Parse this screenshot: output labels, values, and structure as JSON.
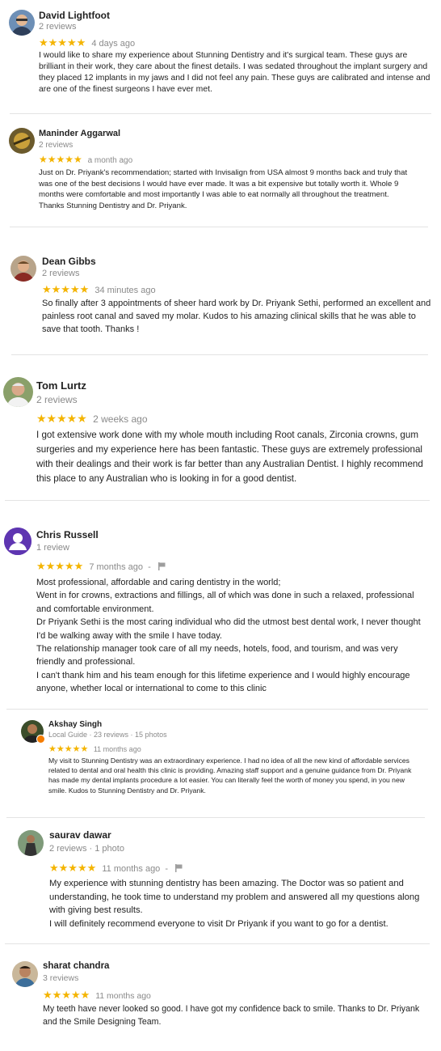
{
  "reviews": [
    {
      "name": "David Lightfoot",
      "meta": "2 reviews",
      "stars": "★★★★★",
      "time": "4 days ago",
      "text": [
        "I would like to share my experience about Stunning Dentistry and it's surgical team. These guys are brilliant in their work, they care about the finest details. I was sedated throughout the implant surgery and they placed 12 implants in my jaws and I did not feel any pain. These guys are calibrated and intense and are one of the finest surgeons I have ever met."
      ]
    },
    {
      "name": "Maninder Aggarwal",
      "meta": "2 reviews",
      "stars": "★★★★★",
      "time": "a month ago",
      "text": [
        "Just on Dr. Priyank's recommendation; started with Invisalign from USA almost 9 months back and truly that was one of the best decisions I would have ever made. It was a bit expensive but totally worth it. Whole 9 months were comfortable and most importantly I was able to eat normally all throughout the treatment. Thanks Stunning Dentistry and Dr. Priyank."
      ]
    },
    {
      "name": "Dean Gibbs",
      "meta": "2 reviews",
      "stars": "★★★★★",
      "time": "34 minutes ago",
      "text": [
        "So finally after 3 appointments of sheer hard work by Dr. Priyank Sethi, performed an excellent and painless root canal and saved my molar. Kudos to his amazing clinical skills that he was able to save that tooth. Thanks !"
      ]
    },
    {
      "name": "Tom Lurtz",
      "meta": "2 reviews",
      "stars": "★★★★★",
      "time": "2 weeks ago",
      "text": [
        "I got extensive work done with my whole mouth including Root canals, Zirconia crowns, gum surgeries and my experience here has been fantastic. These guys are extremely professional with their dealings and their work is far better than any Australian Dentist. I highly recommend this place to any Australian who is looking in for a good dentist."
      ]
    },
    {
      "name": "Chris Russell",
      "meta": "1 review",
      "stars": "★★★★★",
      "time": "7 months ago",
      "sep": "-",
      "text": [
        "Most professional, affordable and caring dentistry in the world;",
        "Went in for crowns, extractions and fillings, all of which was done in such a relaxed, professional and comfortable environment.",
        "Dr Priyank Sethi is the most caring individual who did the utmost best dental work, I never thought I'd be walking away with the smile I have today.",
        "The relationship manager took care of all my needs, hotels, food, and tourism, and was very friendly and professional.",
        "I can't thank him and his team enough for this lifetime experience and I would highly encourage anyone, whether local or international to come to this clinic"
      ]
    },
    {
      "name": "Akshay Singh",
      "meta": "Local Guide · 23 reviews · 15 photos",
      "stars": "★★★★★",
      "time": "11 months ago",
      "text": [
        "My visit to Stunning Dentistry was an extraordinary experience. I had no idea of all the new kind of affordable services related to dental and oral health this clinic is providing. Amazing staff support and a genuine guidance from Dr. Priyank has made my dental implants procedure a lot easier. You can literally feel the worth of money you spend, in you new smile. Kudos to Stunning Dentistry and Dr. Priyank."
      ]
    },
    {
      "name": "saurav dawar",
      "meta": "2 reviews · 1 photo",
      "stars": "★★★★★",
      "time": "11 months ago",
      "sep": "-",
      "text": [
        "My experience with stunning dentistry has been amazing. The Doctor was so patient and understanding, he took time to understand my problem and answered all my questions along with giving best results.",
        "I will definitely recommend everyone to visit Dr Priyank if you want to go for a dentist."
      ]
    },
    {
      "name": "sharat chandra",
      "meta": "3 reviews",
      "stars": "★★★★★",
      "time": "11 months ago",
      "text": [
        "My teeth have never looked so good. I have got my confidence back to smile. Thanks to Dr. Priyank and the Smile Designing Team."
      ]
    }
  ]
}
